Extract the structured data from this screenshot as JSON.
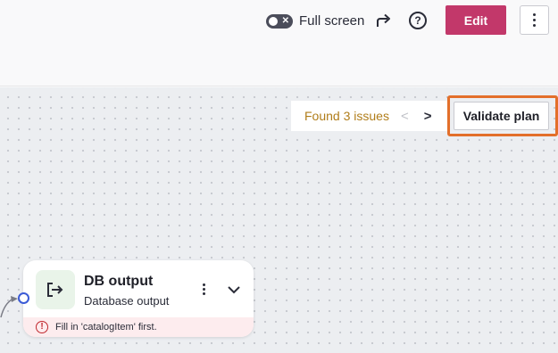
{
  "toolbar": {
    "fullscreen_label": "Full screen",
    "fullscreen_enabled": false,
    "edit_label": "Edit",
    "share_icon": "share-arrow-icon",
    "help_icon": "help-circle-icon",
    "more_icon": "more-vertical-icon"
  },
  "canvas": {
    "issues_text": "Found 3 issues",
    "prev_glyph": "<",
    "next_glyph": ">",
    "validate_label": "Validate plan"
  },
  "node": {
    "title": "DB output",
    "subtitle": "Database output",
    "error_glyph": "!",
    "error_text": "Fill in 'catalogItem' first.",
    "icon": "output-arrow-icon"
  },
  "colors": {
    "accent": "#c2386a",
    "highlight": "#e36f2a",
    "warning_text": "#b07d1a",
    "error": "#c0272d",
    "port": "#3b5bd6"
  }
}
